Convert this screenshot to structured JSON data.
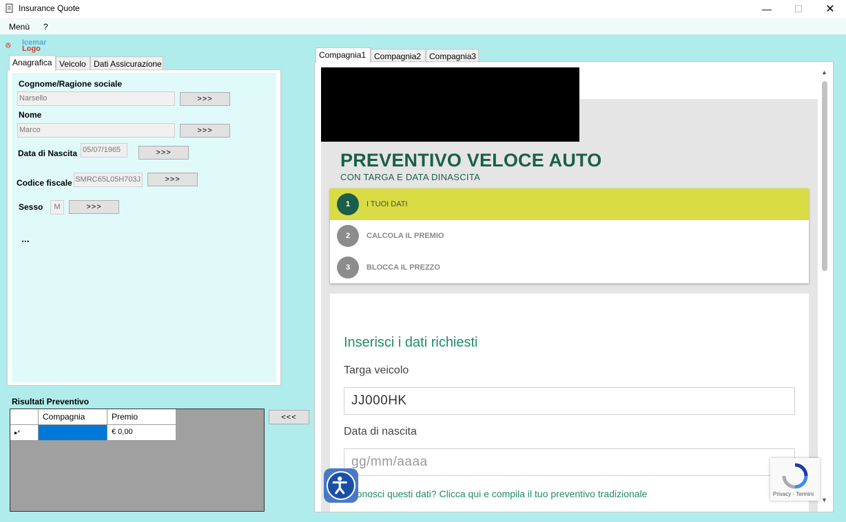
{
  "window": {
    "title": "Insurance Quote",
    "minimize": "—",
    "maximize": "☐",
    "close": "✕"
  },
  "menu": {
    "items": [
      "Menù",
      "?"
    ]
  },
  "logo": {
    "line1": "Icemar",
    "line2": "Logo"
  },
  "left_tabs": [
    "Anagrafica",
    "Veicolo",
    "Dati Assicurazione"
  ],
  "form": {
    "surname_label": "Cognome/Ragione sociale",
    "surname_value": "Narsello",
    "name_label": "Nome",
    "name_value": "Marco",
    "dob_label": "Data di Nascita",
    "dob_value": "05/07/1965",
    "cf_label": "Codice fiscale",
    "cf_value": "SMRC65L05H703J",
    "sex_label": "Sesso",
    "sex_value": "M",
    "push_label": ">>>",
    "more": "..."
  },
  "results": {
    "label": "Risultati Preventivo",
    "columns": [
      "Compagnia",
      "Premio"
    ],
    "rows": [
      {
        "marker": "▸*",
        "compagnia": "",
        "premio": "€ 0,00"
      }
    ],
    "back_label": "<<<"
  },
  "right_tabs": [
    "Compagnia1",
    "Compagnia2",
    "Compagnia3"
  ],
  "web": {
    "headline": "PREVENTIVO VELOCE AUTO",
    "subheadline": "CON TARGA E DATA DINASCITA",
    "steps": [
      {
        "num": "1",
        "label": "I TUOI DATI"
      },
      {
        "num": "2",
        "label": "CALCOLA IL PREMIO"
      },
      {
        "num": "3",
        "label": "BLOCCA IL PREZZO"
      }
    ],
    "form_title": "Inserisci i dati richiesti",
    "plate_label": "Targa veicolo",
    "plate_value": "JJ000HK",
    "dob_label": "Data di nascita",
    "dob_placeholder": "gg/mm/aaaa",
    "link_text": "n conosci questi dati? Clicca qui e compila il tuo preventivo tradizionale",
    "recaptcha": "Privacy - Termini"
  },
  "colors": {
    "accent_green": "#1b5e49",
    "step_active": "#d9dc44",
    "background": "#b0ecec"
  }
}
